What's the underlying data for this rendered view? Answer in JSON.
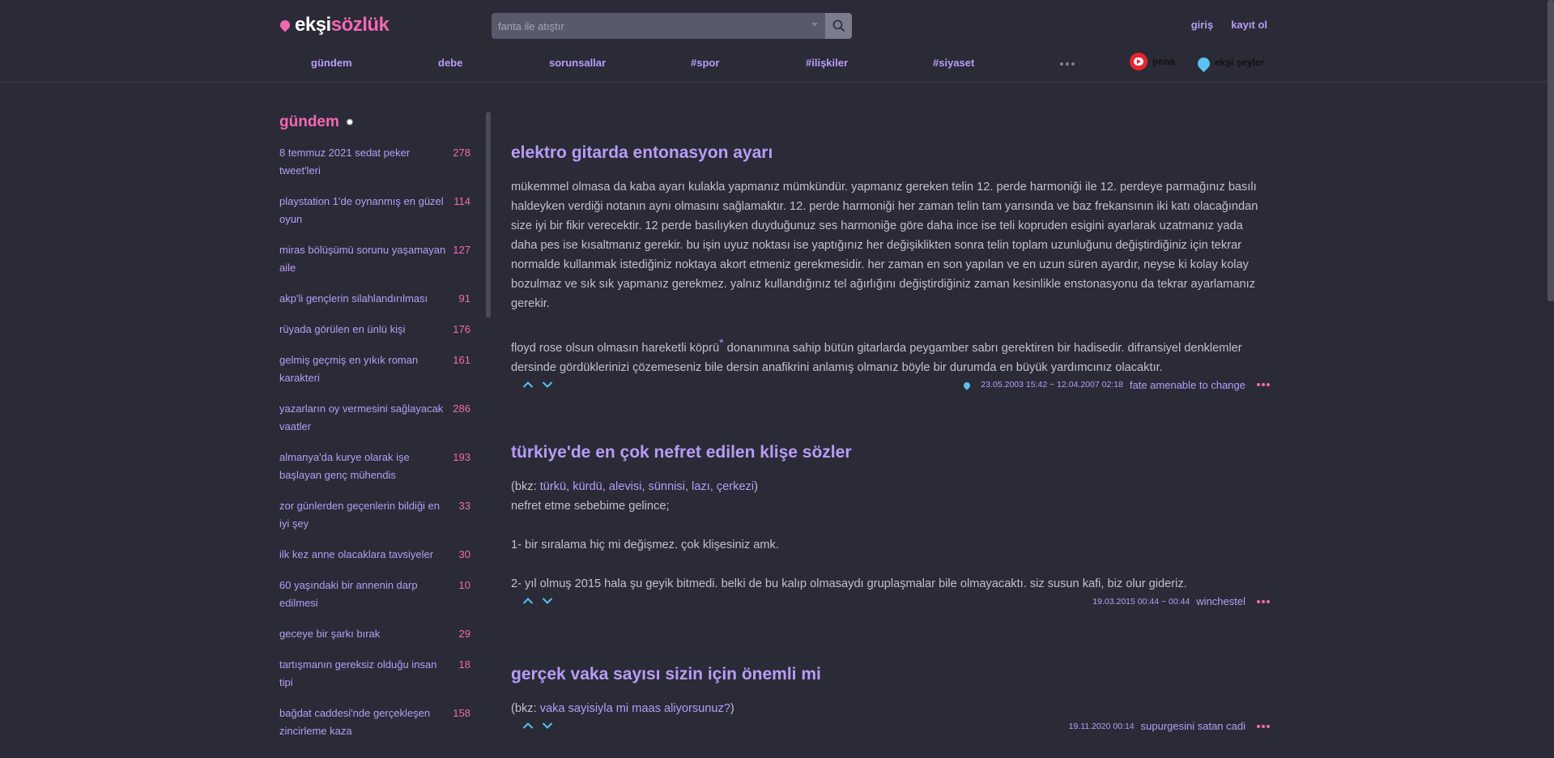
{
  "header": {
    "logo_part1": "ekşi",
    "logo_part2": "sözlük",
    "search_placeholder": "fanta ile atıştır",
    "login": "giriş",
    "register": "kayıt ol"
  },
  "nav": {
    "items": [
      "gündem",
      "debe",
      "sorunsallar",
      "#spor",
      "#ilişkiler",
      "#siyaset"
    ],
    "pena": "pena",
    "eksi_seyler": "ekşi şeyler"
  },
  "sidebar": {
    "title": "gündem",
    "topics": [
      {
        "title": "8 temmuz 2021 sedat peker tweet'leri",
        "count": "278"
      },
      {
        "title": "playstation 1'de oynanmış en güzel oyun",
        "count": "114"
      },
      {
        "title": "miras bölüşümü sorunu yaşamayan aile",
        "count": "127"
      },
      {
        "title": "akp'li gençlerin silahlandırılması",
        "count": "91"
      },
      {
        "title": "rüyada görülen en ünlü kişi",
        "count": "176"
      },
      {
        "title": "gelmiş geçmiş en yıkık roman karakteri",
        "count": "161"
      },
      {
        "title": "yazarların oy vermesini sağlayacak vaatler",
        "count": "286"
      },
      {
        "title": "almanya'da kurye olarak işe başlayan genç mühendis",
        "count": "193"
      },
      {
        "title": "zor günlerden geçenlerin bildiği en iyi şey",
        "count": "33"
      },
      {
        "title": "ilk kez anne olacaklara tavsiyeler",
        "count": "30"
      },
      {
        "title": "60 yaşındaki bir annenin darp edilmesi",
        "count": "10"
      },
      {
        "title": "geceye bir şarkı bırak",
        "count": "29"
      },
      {
        "title": "tartışmanın gereksiz olduğu insan tipi",
        "count": "18"
      },
      {
        "title": "bağdat caddesi'nde gerçekleşen zincirleme kaza",
        "count": "158"
      }
    ]
  },
  "entries": [
    {
      "title": "elektro gitarda entonasyon ayarı",
      "p1": "mükemmel olmasa da kaba ayarı kulakla yapmanız mümkündür. yapmanız gereken telin 12. perde harmoniği ile 12. perdeye parmağınız basılı haldeyken verdiği notanın aynı olmasını sağlamaktır. 12. perde harmoniği her zaman telin tam yarısında ve baz frekansının iki katı olacağından size iyi bir fikir verecektir. 12 perde basılıyken duyduğunuz ses harmoniğe göre daha ince ise teli kopruden esigini ayarlarak uzatmanız yada daha pes ise kısaltmanız gerekir. bu işin uyuz noktası ise yaptığınız her değişiklikten sonra telin toplam uzunluğunu değiştirdiğiniz için tekrar normalde kullanmak istediğiniz noktaya akort etmeniz gerekmesidir. her zaman en son yapılan ve en uzun süren ayardır, neyse ki kolay kolay bozulmaz ve sık sık yapmanız gerekmez. yalnız kullandığınız tel ağırlığını değiştirdiğiniz zaman kesinlikle enstonasyonu da tekrar ayarlamanız gerekir.",
      "p2a": "floyd rose olsun olmasın hareketli köprü",
      "p2sup": "*",
      "p2b": " donanımına sahip bütün gitarlarda peygamber sabrı gerektiren bir hadisedir. difransiyel denklemler dersinde gördüklerinizi çözemeseniz bile dersin anafikrini anlamış olmanız böyle bir durumda en büyük yardımcınız olacaktır.",
      "date": "23.05.2003 15:42 ~ 12.04.2007 02:18",
      "author": "fate amenable to change"
    },
    {
      "title": "türkiye'de en çok nefret edilen klişe sözler",
      "bkz_open": "(bkz: ",
      "bkz_links": "türkü, kürdü, alevisi, sünnisi, lazı, çerkezi",
      "bkz_close": ")",
      "l1": "nefret etme sebebime gelince;",
      "l2": "1- bir sıralama hiç mi değişmez. çok klişesiniz amk.",
      "l3": "2- yıl olmuş 2015 hala şu geyik bitmedi. belki de bu kalıp olmasaydı gruplaşmalar bile olmayacaktı. siz susun kafi, biz olur gideriz.",
      "date": "19.03.2015 00:44 ~ 00:44",
      "author": "winchestel"
    },
    {
      "title": "gerçek vaka sayısı sizin için önemli mi",
      "bkz_open": "(bkz: ",
      "bkz_link": "vaka sayisiyla mi maas aliyorsunuz?",
      "bkz_close": ")",
      "date": "19.11.2020 00:14",
      "author": "supurgesini satan cadi"
    }
  ],
  "colors": {
    "background": "#2a2b36",
    "accent_purple": "#b89cf8",
    "accent_pink": "#f368b4",
    "drop_blue": "#5bc1ef"
  }
}
